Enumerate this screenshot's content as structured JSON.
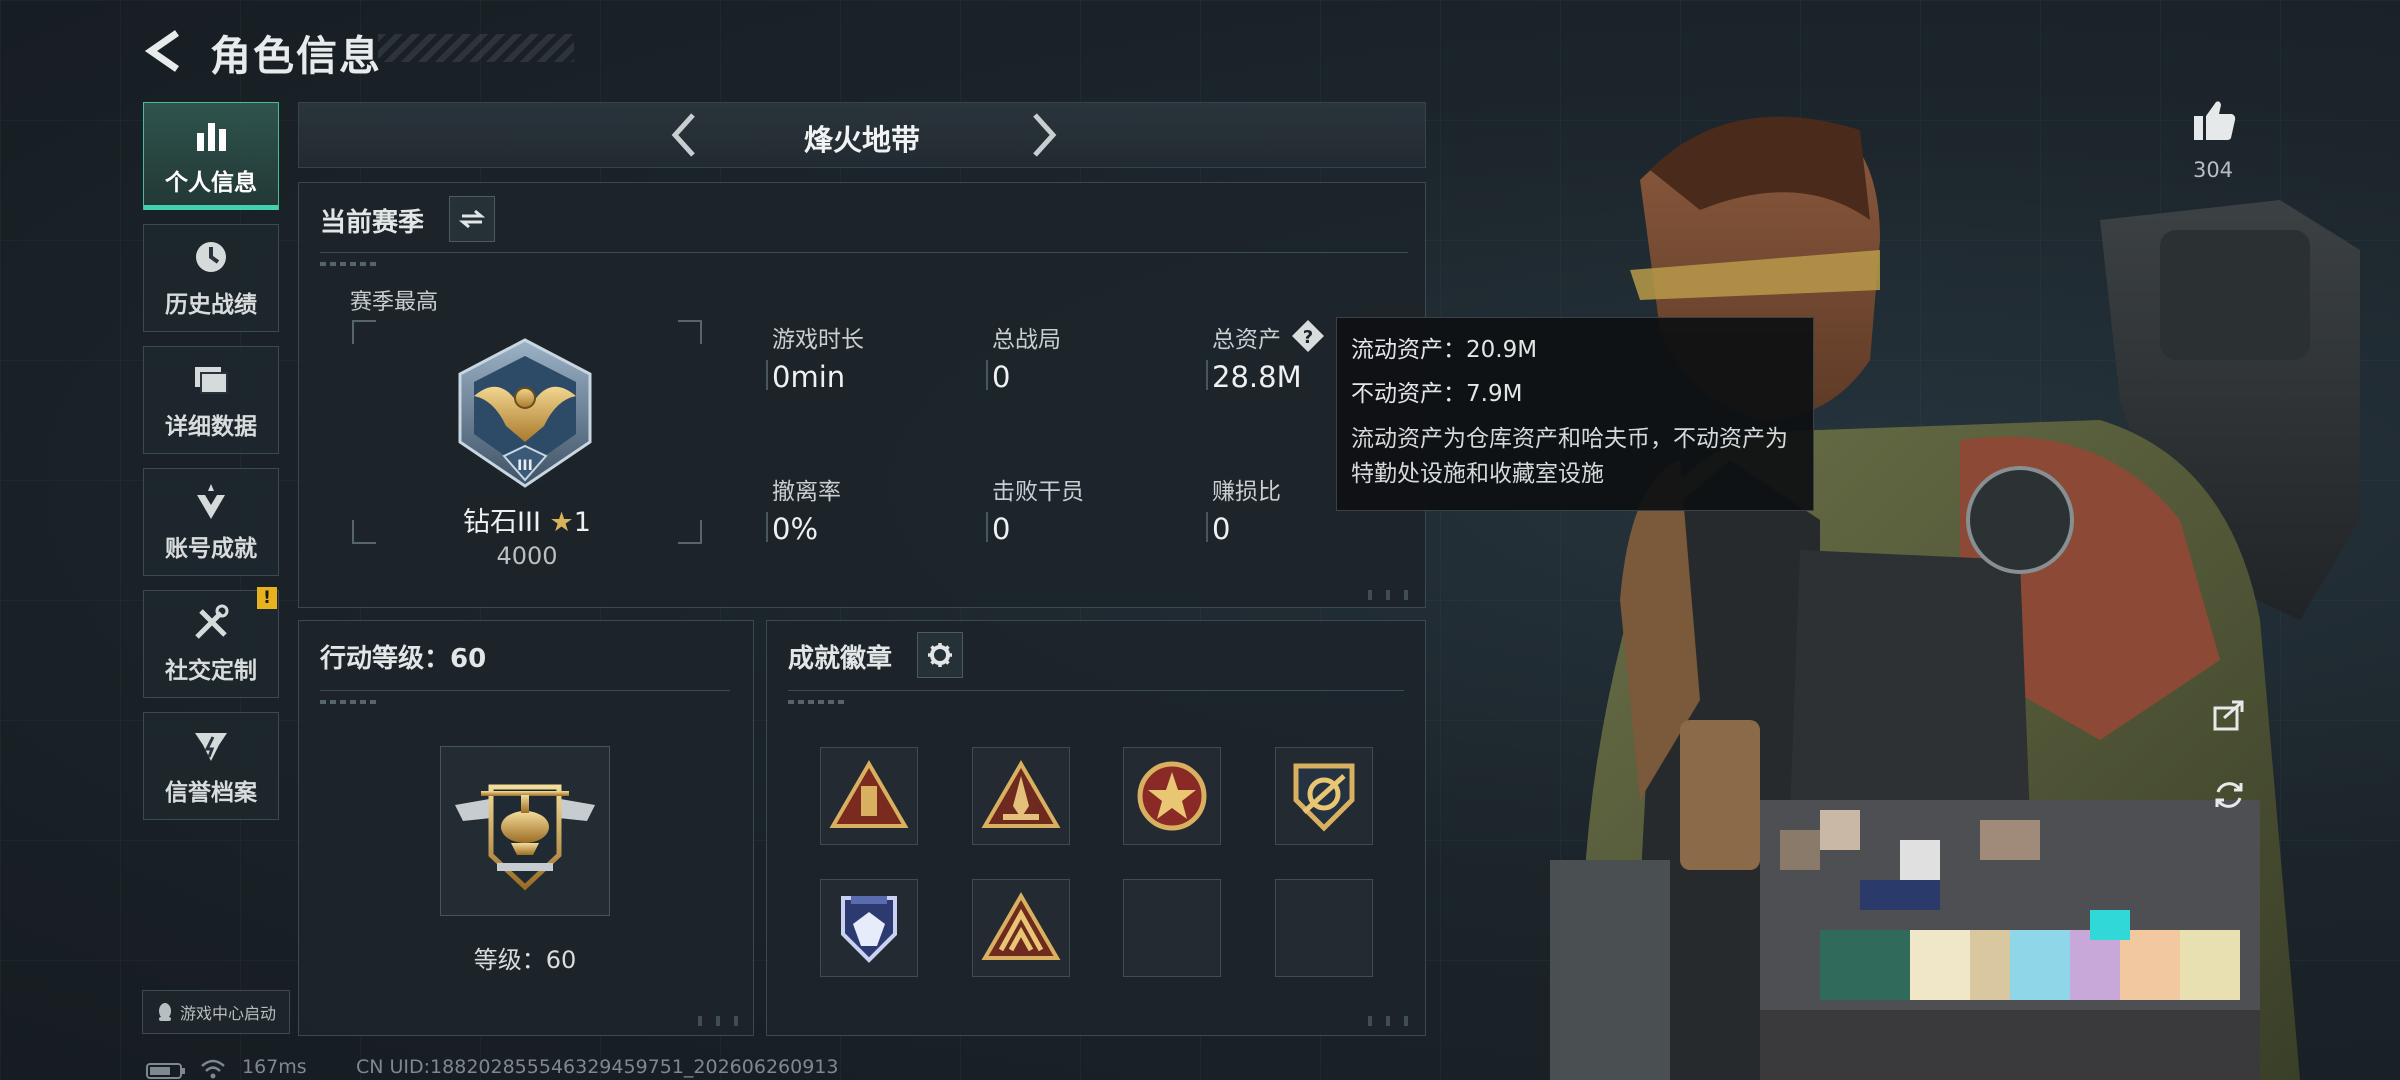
{
  "header": {
    "title": "角色信息"
  },
  "sidebar": {
    "items": [
      {
        "label": "个人信息",
        "icon": "bar-chart-icon",
        "active": true
      },
      {
        "label": "历史战绩",
        "icon": "history-icon"
      },
      {
        "label": "详细数据",
        "icon": "folder-icon"
      },
      {
        "label": "账号成就",
        "icon": "achievement-icon"
      },
      {
        "label": "社交定制",
        "icon": "tools-icon",
        "badge": "!"
      },
      {
        "label": "信誉档案",
        "icon": "emblem-icon"
      }
    ],
    "launch_label": "游戏中心启动"
  },
  "mode": {
    "title": "烽火地带"
  },
  "season": {
    "title": "当前赛季",
    "best_label": "赛季最高",
    "rank_name": "钻石III",
    "rank_stars": "1",
    "rank_points": "4000",
    "stats": [
      {
        "label": "游戏时长",
        "value": "0min"
      },
      {
        "label": "总战局",
        "value": "0"
      },
      {
        "label": "总资产",
        "value": "28.8M",
        "has_help": true
      },
      {
        "label": "撤离率",
        "value": "0%"
      },
      {
        "label": "击败干员",
        "value": "0"
      },
      {
        "label": "赚损比",
        "value": "0"
      }
    ]
  },
  "tooltip": {
    "liquid": "流动资产：20.9M",
    "fixed": "不动资产：7.9M",
    "desc": "流动资产为仓库资产和哈夫币，不动资产为特勤处设施和收藏室设施"
  },
  "action_level": {
    "title": "行动等级：60",
    "level_text": "等级：60"
  },
  "achievements": {
    "title": "成就徽章",
    "slots": 8,
    "filled": 6
  },
  "likes": {
    "count": "304"
  },
  "footer": {
    "ping": "167ms",
    "uid": "CN UID:188202855546329459751_202606260913"
  },
  "colors": {
    "accent": "#42d0ad",
    "warning": "#e8b21e",
    "panel": "#1c242a"
  }
}
